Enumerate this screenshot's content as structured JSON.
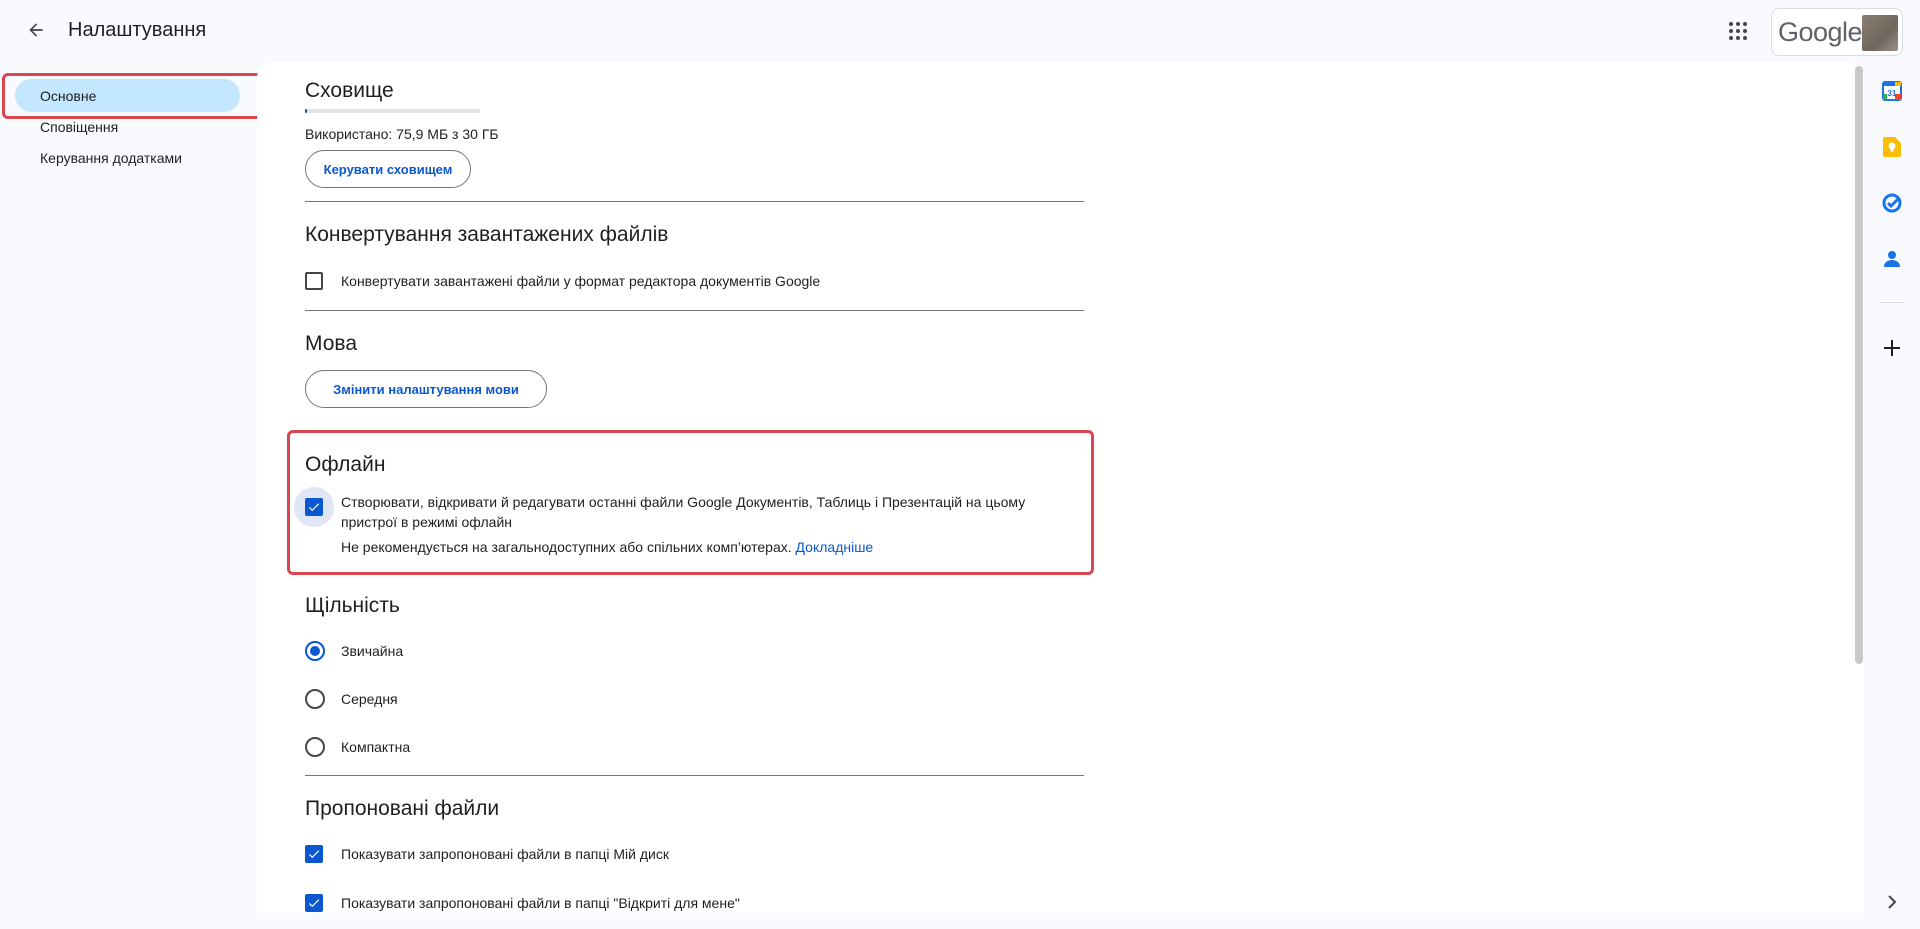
{
  "header": {
    "title": "Налаштування",
    "logo_text": "Google"
  },
  "sidebar": {
    "items": [
      {
        "label": "Основне",
        "active": true
      },
      {
        "label": "Сповіщення",
        "active": false
      },
      {
        "label": "Керування додатками",
        "active": false
      }
    ]
  },
  "storage": {
    "title": "Сховище",
    "used_text": "Використано: 75,9 МБ з 30 ГБ",
    "used_fraction": 0.0025,
    "button": "Керувати сховищем"
  },
  "convert": {
    "title": "Конвертування завантажених файлів",
    "checkbox_label": "Конвертувати завантажені файли у формат редактора документів Google",
    "checked": false
  },
  "language": {
    "title": "Мова",
    "button": "Змінити налаштування мови"
  },
  "offline": {
    "title": "Офлайн",
    "checkbox_label_line1": "Створювати, відкривати й редагувати останні файли Google Документів, Таблиць і Презентацій на цьому",
    "checkbox_label_line2": "пристрої в режимі офлайн",
    "note": "Не рекомендується на загальнодоступних або спільних комп’ютерах.",
    "link": "Докладніше",
    "checked": true
  },
  "density": {
    "title": "Щільність",
    "options": [
      {
        "label": "Звичайна",
        "selected": true
      },
      {
        "label": "Середня",
        "selected": false
      },
      {
        "label": "Компактна",
        "selected": false
      }
    ]
  },
  "suggested": {
    "title": "Пропоновані файли",
    "items": [
      {
        "label": "Показувати запропоновані файли в папці Мій диск",
        "checked": true
      },
      {
        "label": "Показувати запропоновані файли в папці \"Відкриті для мене\"",
        "checked": true
      }
    ]
  },
  "rail": {
    "calendar_day": "31"
  },
  "colors": {
    "accent": "#0b57d0",
    "active_nav": "#c2e7ff",
    "highlight_box": "#d9464f"
  }
}
